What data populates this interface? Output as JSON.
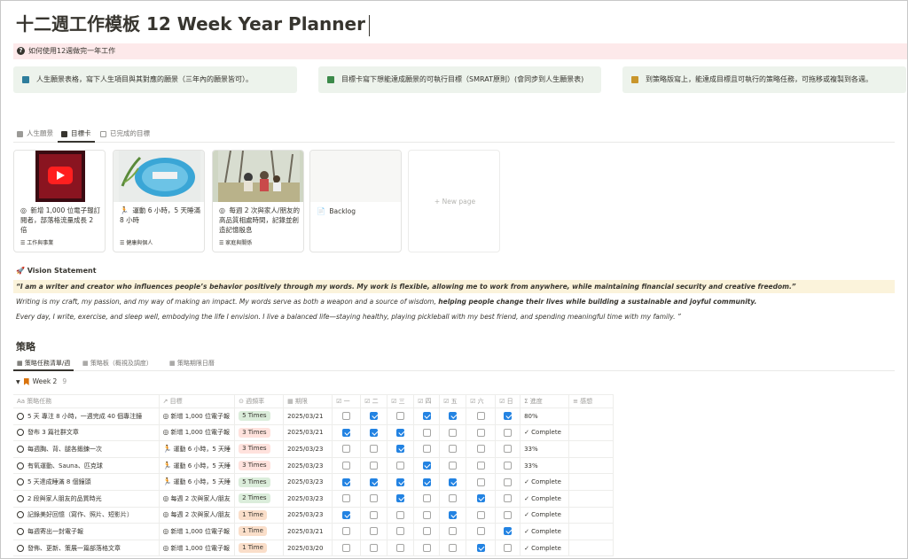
{
  "page": {
    "title": "十二週工作模板 12 Week Year Planner",
    "howto": "如何使用12週做完一年工作"
  },
  "callouts": [
    {
      "text": "人生願景表格，寫下人生項目與其對應的願景（三年內的願景皆可）。",
      "color": "#2e7d9c"
    },
    {
      "text": "目標卡寫下想能達成願景的可執行目標（SMRAT原則）(會同步到人生願景表)",
      "color": "#3c8a4a"
    },
    {
      "text": "到策略版寫上，能達成目標且可執行的策略任務，可拖移或複製到各週。",
      "color": "#c9962c"
    }
  ],
  "tabs": [
    {
      "label": "人生願景",
      "active": false
    },
    {
      "label": "目標卡",
      "active": true
    },
    {
      "label": "已完成的目標",
      "active": false
    }
  ],
  "cards": [
    {
      "icon": "◎",
      "title": "新增 1,000 位電子報訂閱者，部落格流量成長 2 倍",
      "tag": "工作與事業"
    },
    {
      "icon": "🏃",
      "title": "運動 6 小時，5 天睡滿 8 小時",
      "tag": "健康與個人"
    },
    {
      "icon": "◎",
      "title": "每週 2 次與家人/朋友的高品質相處時間，記錄並創造記憶殷息",
      "tag": "家庭與關係"
    },
    {
      "icon": "📄",
      "title": "Backlog",
      "tag": ""
    },
    {
      "new_page": "+ New page"
    }
  ],
  "vision": {
    "heading": "🚀 Vision Statement",
    "quote": "“I am a writer and creator who influences people’s behavior positively through my words. My work is flexible, allowing me to work from anywhere, while maintaining financial security and creative freedom.”",
    "line1_a": "Writing is my craft, my passion, and my way of making an impact. My words serve as both a weapon and a source of wisdom, ",
    "line1_b": "helping people change their lives while building a sustainable and joyful community.",
    "line2": "Every day, I write, exercise, and sleep well, embodying the life I envision. I live a balanced life—staying healthy, playing pickleball with my best friend, and spending meaningful time with my family. ”"
  },
  "strategy": {
    "heading": "策略",
    "tabs": [
      {
        "label": "策略任務清單/週",
        "active": true
      },
      {
        "label": "策略板（概視及調度）",
        "active": false
      },
      {
        "label": "策略期限日曆",
        "active": false
      }
    ],
    "group": {
      "label": "Week 2",
      "count": "9"
    },
    "columns": [
      "Aa 策略任務",
      "↗ 目標",
      "⊙ 週頻率",
      "▦ 期限",
      "☑ 一",
      "☑ 二",
      "☑ 三",
      "☑ 四",
      "☑ 五",
      "☑ 六",
      "☑ 日",
      "Σ 進度",
      "≡ 感想"
    ],
    "rows": [
      {
        "task": "5 天 專注 8 小時，一週完成 40 個專注鐘",
        "goal_icon": "◎",
        "goal": "新增 1,000 位電子報",
        "freq": "5 Times",
        "freq_class": "t5",
        "due": "2025/03/21",
        "checks": [
          false,
          true,
          false,
          true,
          true,
          false,
          true
        ],
        "progress": "80%"
      },
      {
        "task": "發布 3 篇社群文章",
        "goal_icon": "◎",
        "goal": "新增 1,000 位電子報",
        "freq": "3 Times",
        "freq_class": "t3",
        "due": "2025/03/21",
        "checks": [
          true,
          true,
          true,
          false,
          false,
          false,
          false
        ],
        "progress": "✓ Complete"
      },
      {
        "task": "每週胸、背、腿各鍛鍊一次",
        "goal_icon": "🏃",
        "goal": "運動 6 小時，5 天睡",
        "freq": "3 Times",
        "freq_class": "t3",
        "due": "2025/03/23",
        "checks": [
          false,
          false,
          true,
          false,
          false,
          false,
          false
        ],
        "progress": "33%"
      },
      {
        "task": "有氧運動、Sauna、匹克球",
        "goal_icon": "🏃",
        "goal": "運動 6 小時，5 天睡",
        "freq": "3 Times",
        "freq_class": "t3",
        "due": "2025/03/23",
        "checks": [
          false,
          false,
          false,
          true,
          false,
          false,
          false
        ],
        "progress": "33%"
      },
      {
        "task": "5 天達成睡滿 8 個鐘頭",
        "goal_icon": "🏃",
        "goal": "運動 6 小時，5 天睡",
        "freq": "5 Times",
        "freq_class": "t5",
        "due": "2025/03/23",
        "checks": [
          true,
          true,
          true,
          true,
          true,
          false,
          false
        ],
        "progress": "✓ Complete"
      },
      {
        "task": "2 段與家人朋友的品質時光",
        "goal_icon": "◎",
        "goal": "每週 2 次與家人/朋友",
        "freq": "2 Times",
        "freq_class": "t2",
        "due": "2025/03/23",
        "checks": [
          false,
          false,
          true,
          false,
          false,
          true,
          false
        ],
        "progress": "✓ Complete"
      },
      {
        "task": "記錄美好回憶（寫作、照片、短影片）",
        "goal_icon": "◎",
        "goal": "每週 2 次與家人/朋友",
        "freq": "1 Time",
        "freq_class": "t1",
        "due": "2025/03/23",
        "checks": [
          true,
          false,
          false,
          false,
          true,
          false,
          false
        ],
        "progress": "✓ Complete"
      },
      {
        "task": "每週寄出一封電子報",
        "goal_icon": "◎",
        "goal": "新增 1,000 位電子報",
        "freq": "1 Time",
        "freq_class": "t1",
        "due": "2025/03/21",
        "checks": [
          false,
          false,
          false,
          false,
          false,
          false,
          true
        ],
        "progress": "✓ Complete"
      },
      {
        "task": "發佈、更新、策展一篇部落格文章",
        "goal_icon": "◎",
        "goal": "新增 1,000 位電子報",
        "freq": "1 Time",
        "freq_class": "t1",
        "due": "2025/03/20",
        "checks": [
          false,
          false,
          false,
          false,
          false,
          true,
          false
        ],
        "progress": "✓ Complete"
      }
    ]
  }
}
